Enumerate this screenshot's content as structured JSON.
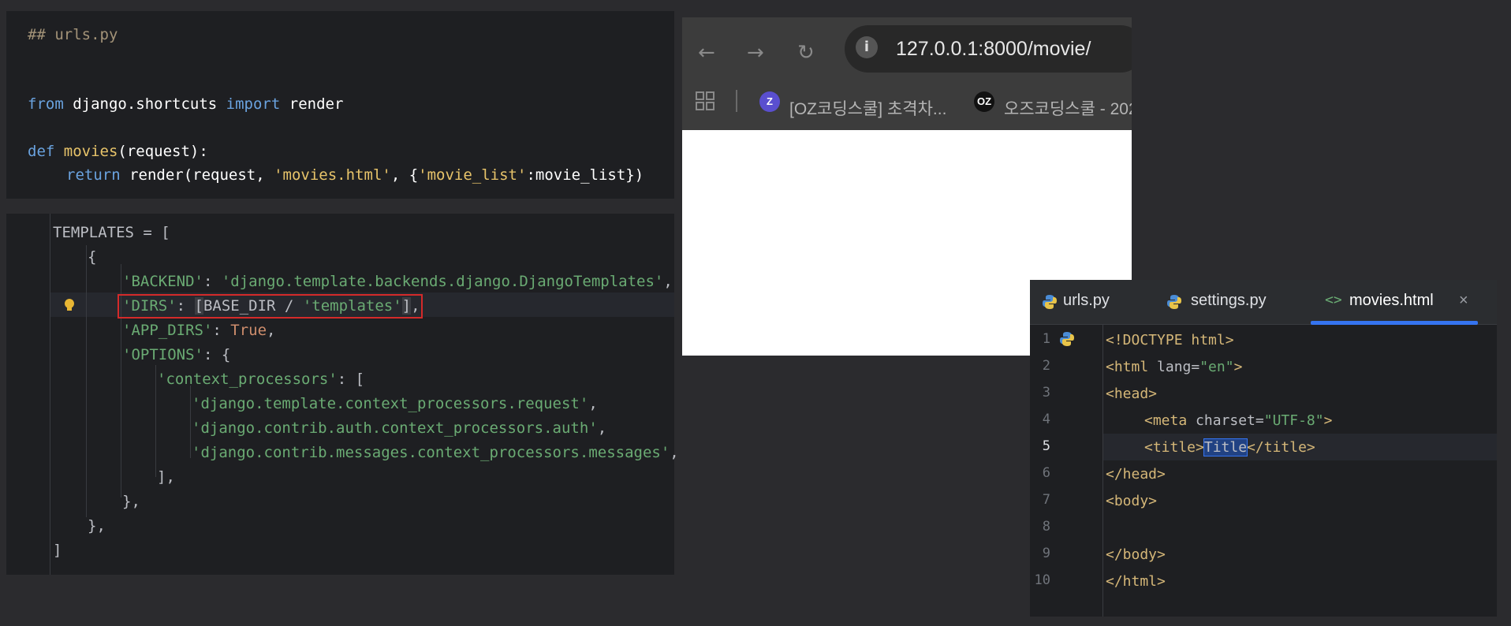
{
  "editor1": {
    "comment": "## urls.py",
    "line_import": {
      "from": "from",
      "module": " django.shortcuts ",
      "import": "import",
      "name": " render"
    },
    "line_def": {
      "def": "def",
      "fn": "movies",
      "args": "(request):"
    },
    "line_return": {
      "return": "return",
      "call": " render(request, ",
      "template": "'movies.html'",
      "sep": ", {",
      "key": "'movie_list'",
      "rest": ":movie_list})"
    }
  },
  "editor2": {
    "lines": [
      "TEMPLATES = [",
      "{",
      "'BACKEND': 'django.template.backends.django.DjangoTemplates',",
      "'DIRS': [BASE_DIR / 'templates'],",
      "'APP_DIRS': True,",
      "'OPTIONS': {",
      "'context_processors': [",
      "'django.template.context_processors.request',",
      "'django.contrib.auth.context_processors.auth',",
      "'django.contrib.messages.context_processors.messages',",
      "],",
      "},",
      "},",
      "]"
    ],
    "backend_key": "'BACKEND'",
    "backend_val": "'django.template.backends.django.DjangoTemplates'",
    "dirs_key": "'DIRS'",
    "dirs_base": "BASE_DIR / ",
    "dirs_val": "'templates'",
    "appdirs_key": "'APP_DIRS'",
    "appdirs_val": "True",
    "options_key": "'OPTIONS'",
    "cp_key": "'context_processors'",
    "cp1": "'django.template.context_processors.request'",
    "cp2": "'django.contrib.auth.context_processors.auth'",
    "cp3": "'django.contrib.messages.context_processors.messages'"
  },
  "browser": {
    "url": "127.0.0.1:8000/movie/",
    "bookmark1": "[OZ코딩스쿨] 초격차...",
    "bookmark2": "오즈코딩스쿨 - 202",
    "bookmark2_icon": "OZ",
    "bookmark1_icon": "Z"
  },
  "editor3": {
    "tabs": [
      "urls.py",
      "settings.py",
      "movies.html"
    ],
    "line_numbers": [
      "1",
      "2",
      "3",
      "4",
      "5",
      "6",
      "7",
      "8",
      "9",
      "10"
    ],
    "doctype": "<!DOCTYPE html>",
    "html_open": "<html",
    "lang_attr": " lang=",
    "lang_val": "\"en\"",
    "html_close_bracket": ">",
    "head_open": "<head>",
    "meta_open": "<meta",
    "charset_attr": " charset=",
    "charset_val": "\"UTF-8\"",
    "meta_close": ">",
    "title_open": "<title>",
    "title_text": "Title",
    "title_close": "</title>",
    "head_close": "</head>",
    "body_open": "<body>",
    "body_close": "</body>",
    "html_close": "</html>"
  }
}
